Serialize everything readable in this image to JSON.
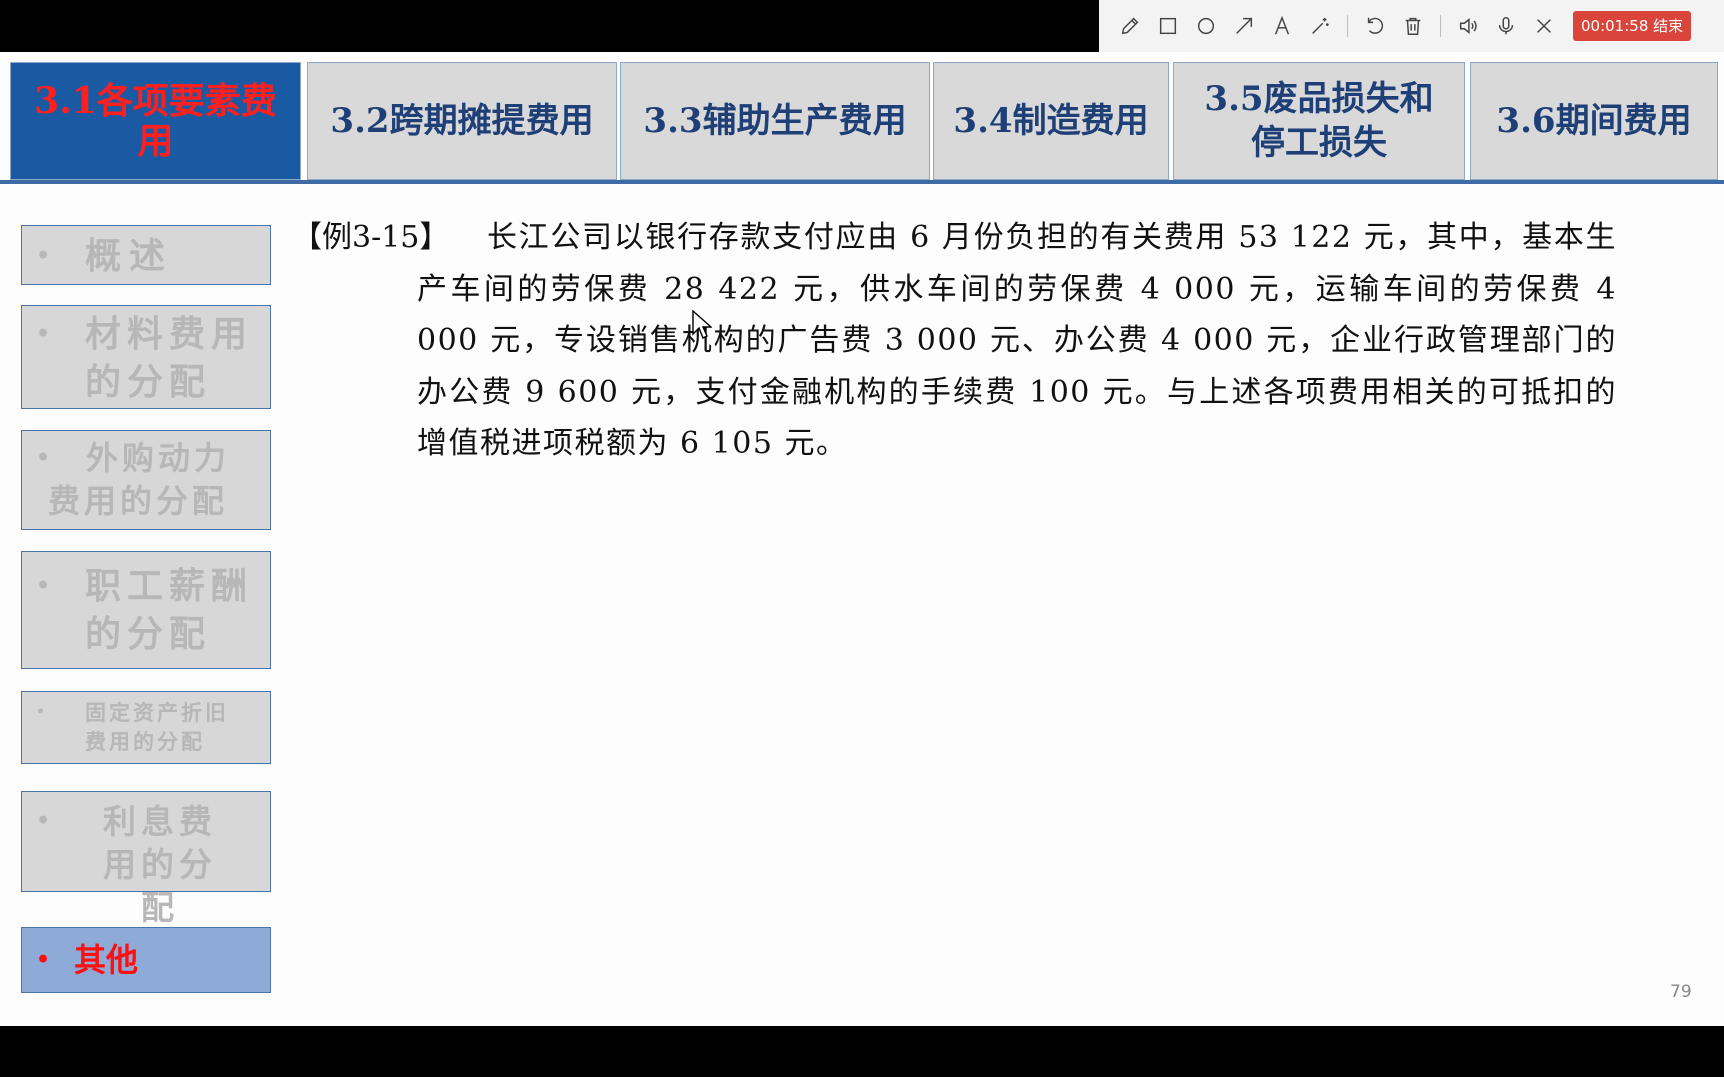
{
  "toolbar": {
    "icons": [
      "pencil-icon",
      "rectangle-icon",
      "circle-icon",
      "arrow-icon",
      "text-icon",
      "magic-wand-icon",
      "undo-icon",
      "trash-icon",
      "speaker-icon",
      "microphone-icon",
      "close-icon"
    ],
    "timer_label": "00:01:58 结束",
    "timer_color": "#d9453a"
  },
  "tabs": [
    {
      "label": "3.1各项要素费用",
      "active": true
    },
    {
      "label": "3.2跨期摊提费用",
      "active": false
    },
    {
      "label": "3.3辅助生产费用",
      "active": false
    },
    {
      "label": "3.4制造费用",
      "active": false
    },
    {
      "label": "3.5废品损失和停工损失",
      "active": false
    },
    {
      "label": "3.6期间费用",
      "active": false
    }
  ],
  "sidebar": {
    "items": [
      {
        "label": "概述",
        "active": false
      },
      {
        "label": "材料费用的分配",
        "active": false
      },
      {
        "label": "外购动力费用的分配",
        "active": false
      },
      {
        "label": "职工薪酬的分配",
        "active": false
      },
      {
        "label": "固定资产折旧费用的分配",
        "active": false
      },
      {
        "label": "利息费用的分配",
        "active": false
      },
      {
        "label": "其他",
        "active": true
      }
    ],
    "bullet": "•"
  },
  "content": {
    "example_label": "【例3-15】",
    "example_text": "长江公司以银行存款支付应由 6 月份负担的有关费用 53 122 元，其中，基本生产车间的劳保费 28 422 元，供水车间的劳保费 4 000 元，运输车间的劳保费 4 000 元，专设销售机构的广告费 3 000 元、办公费 4 000 元，企业行政管理部门的办公费 9 600 元，支付金融机构的手续费 100 元。与上述各项费用相关的可抵扣的增值税进项税额为 6 105 元。"
  },
  "page_number": "79",
  "colors": {
    "active_tab_bg": "#1a5aa3",
    "active_tab_text": "#ff1f1f",
    "tab_text": "#1f3f77",
    "active_side_bg": "#8eabd8"
  }
}
